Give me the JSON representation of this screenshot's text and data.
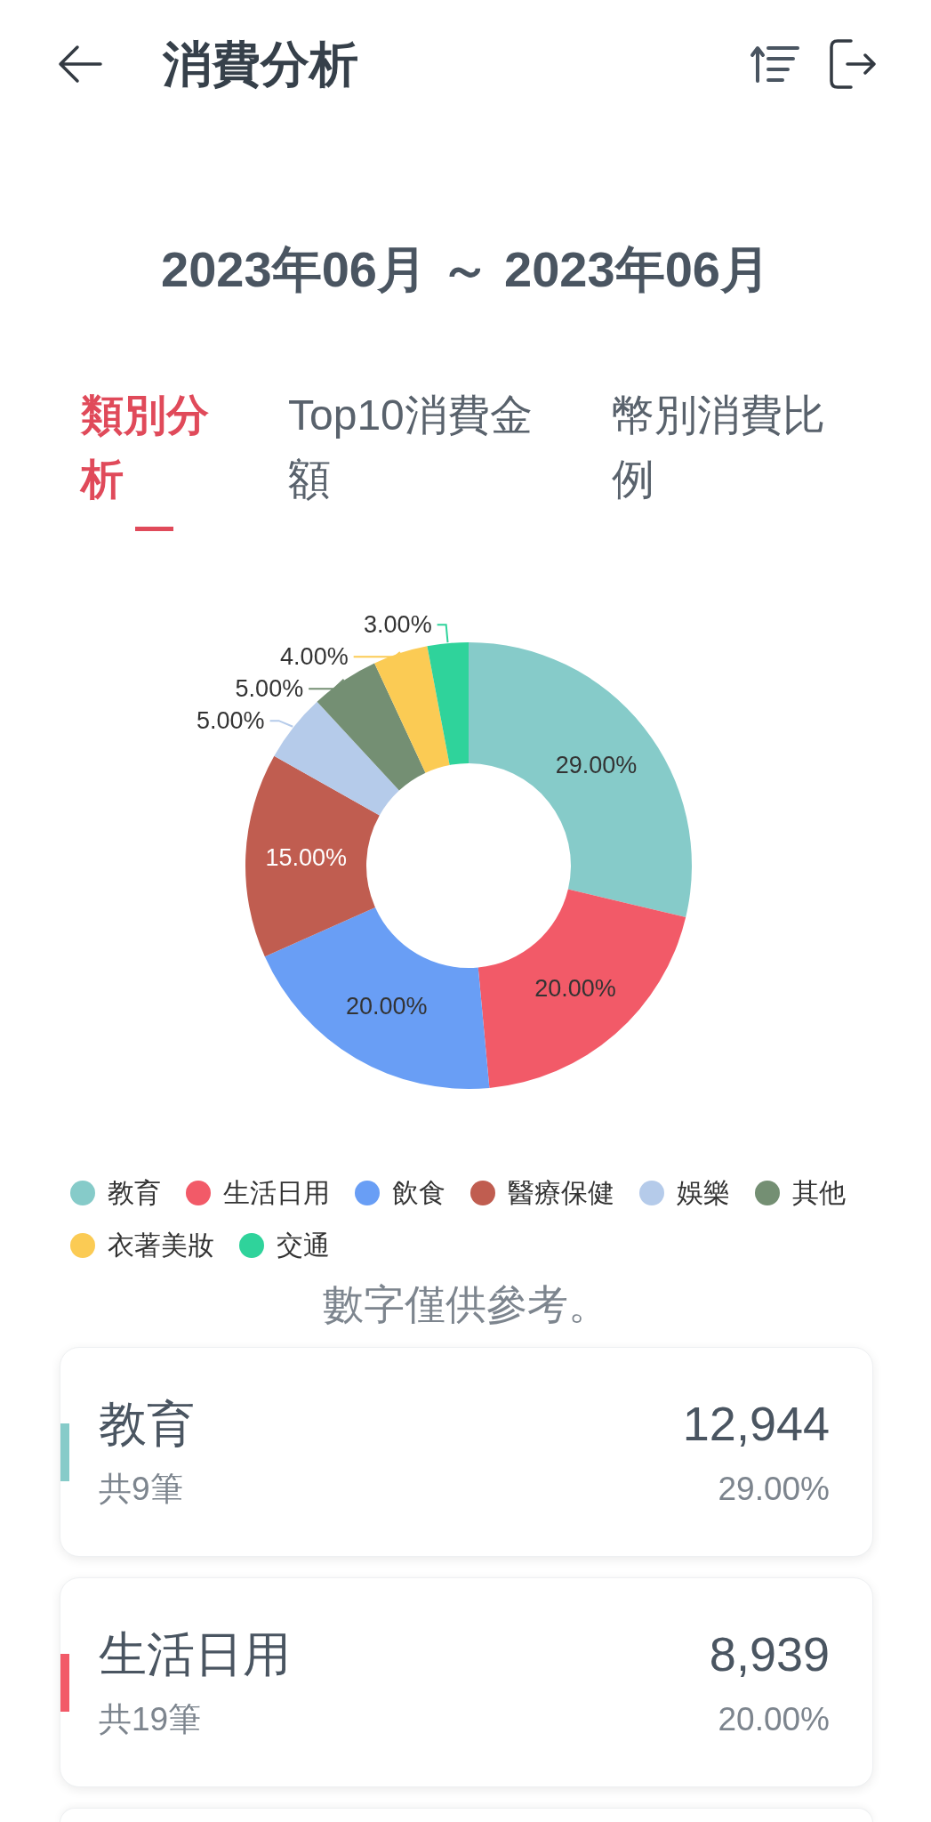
{
  "header": {
    "title": "消費分析"
  },
  "date_range": "2023年06月 ～ 2023年06月",
  "tabs": [
    {
      "label": "類別分析",
      "selected": true
    },
    {
      "label": "Top10消費金額",
      "selected": false
    },
    {
      "label": "幣別消費比例",
      "selected": false
    }
  ],
  "chart": {
    "chart_data": {
      "type": "donut",
      "values": [
        29,
        20,
        20,
        15,
        5,
        5,
        4,
        3
      ],
      "value_labels": [
        "29.00%",
        "20.00%",
        "20.00%",
        "15.00%",
        "5.00%",
        "5.00%",
        "4.00%",
        "3.00%"
      ]
    }
  },
  "legend": [
    {
      "label": "教育",
      "color": "#86cbc9"
    },
    {
      "label": "生活日用",
      "color": "#f25a68"
    },
    {
      "label": "飲食",
      "color": "#699ef5"
    },
    {
      "label": "醫療保健",
      "color": "#c05d50"
    },
    {
      "label": "娛樂",
      "color": "#b5cbea"
    },
    {
      "label": "其他",
      "color": "#748f73"
    },
    {
      "label": "衣著美妝",
      "color": "#fbcb54"
    },
    {
      "label": "交通",
      "color": "#2fd39b"
    }
  ],
  "note": "數字僅供參考。",
  "cards": [
    {
      "name": "教育",
      "count": "共9筆",
      "amount": "12,944",
      "percent": "29.00%",
      "color": "#86cbc9"
    },
    {
      "name": "生活日用",
      "count": "共19筆",
      "amount": "8,939",
      "percent": "20.00%",
      "color": "#f25a68"
    }
  ]
}
